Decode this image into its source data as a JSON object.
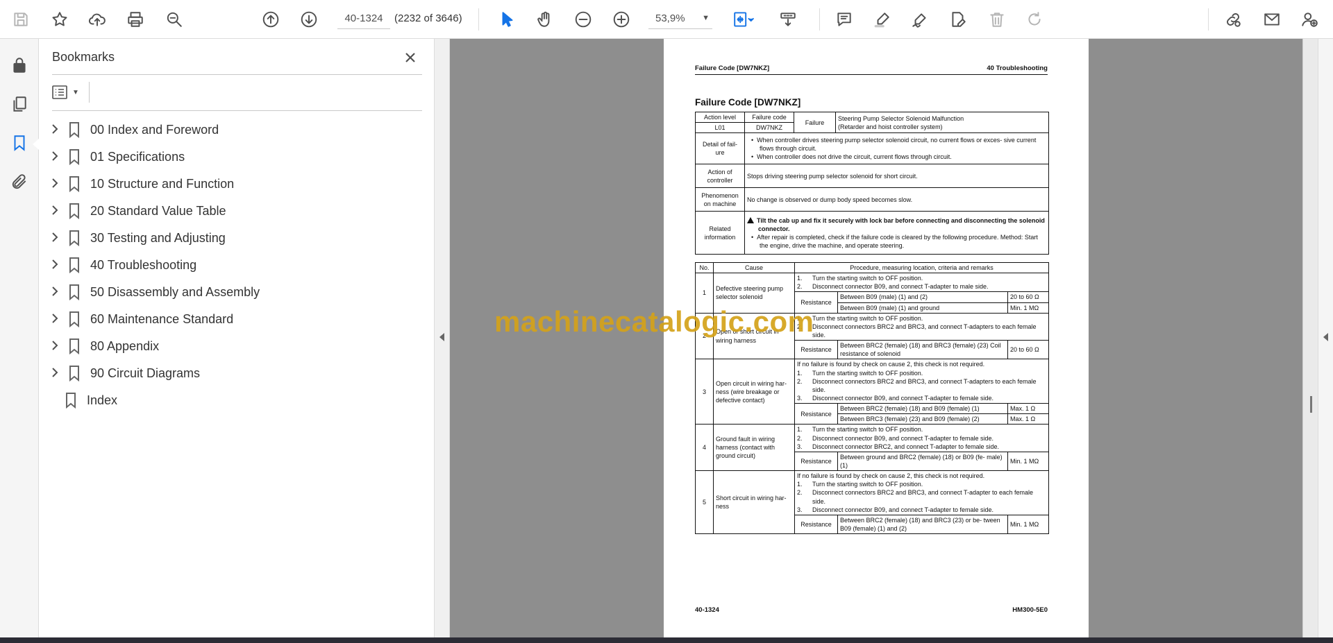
{
  "toolbar": {
    "page_value": "40-1324",
    "page_count": "(2232 of 3646)",
    "zoom": "53,9%"
  },
  "panel": {
    "title": "Bookmarks",
    "bookmarks": [
      {
        "label": "00 Index and Foreword"
      },
      {
        "label": "01 Specifications"
      },
      {
        "label": "10 Structure and Function"
      },
      {
        "label": "20 Standard Value Table"
      },
      {
        "label": "30 Testing and Adjusting"
      },
      {
        "label": "40 Troubleshooting"
      },
      {
        "label": "50 Disassembly and Assembly"
      },
      {
        "label": "60 Maintenance Standard"
      },
      {
        "label": "80 Appendix"
      },
      {
        "label": "90 Circuit Diagrams"
      },
      {
        "label": "Index"
      }
    ]
  },
  "document": {
    "header_left": "Failure Code [DW7NKZ]",
    "header_right": "40 Troubleshooting",
    "title": "Failure Code [DW7NKZ]",
    "info": {
      "action_level_h": "Action level",
      "failure_code_h": "Failure code",
      "failure_h": "Failure",
      "action_level": "L01",
      "failure_code": "DW7NKZ",
      "failure_1": "Steering Pump Selector Solenoid Malfunction",
      "failure_2": "(Retarder and hoist controller system)",
      "detail_h": "Detail of fail- ure",
      "detail_1": "When controller drives steering pump selector solenoid circuit, no current flows or exces- sive current flows through circuit.",
      "detail_2": "When controller does not drive the circuit, current flows through circuit.",
      "action_h": "Action of controller",
      "action": "Stops driving steering pump selector solenoid for short circuit.",
      "phenom_h": "Phenomenon on machine",
      "phenom": "No change is observed or dump body speed becomes slow.",
      "related_h": "Related information",
      "related_warn": "Tilt the cab up and fix it securely with lock bar before connecting and disconnecting the solenoid connector.",
      "related_1": "After repair is completed, check if the failure code is cleared by the following procedure. Method: Start the engine, drive the machine, and operate steering."
    },
    "causes_header": {
      "no": "No.",
      "cause": "Cause",
      "proc": "Procedure, measuring location, criteria and remarks"
    },
    "resistance": "Resistance",
    "c1": {
      "no": "1",
      "cause": "Defective steering pump selector solenoid",
      "s1": "Turn the starting switch to OFF position.",
      "s2": "Disconnect connector B09, and connect T-adapter to male side.",
      "r1": "Between B09 (male) (1) and (2)",
      "v1": "20 to 60 Ω",
      "r2": "Between B09 (male) (1) and ground",
      "v2": "Min. 1 MΩ"
    },
    "c2": {
      "no": "2",
      "cause": "Open or short circuit in wiring harness",
      "s1": "Turn the starting switch to OFF position.",
      "s2": "Disconnect connectors BRC2 and BRC3, and connect T-adapters to each female side.",
      "r1": "Between BRC2 (female) (18) and BRC3 (female) (23) Coil resistance of solenoid",
      "v1": "20 to 60 Ω"
    },
    "c3": {
      "no": "3",
      "cause": "Open circuit in wiring har- ness (wire breakage or defective contact)",
      "note": "If no failure is found by check on cause 2, this check is not required.",
      "s1": "Turn the starting switch to OFF position.",
      "s2": "Disconnect connectors BRC2 and BRC3, and connect T-adapters to each female side.",
      "s3": "Disconnect connector B09, and connect T-adapter to female side.",
      "r1": "Between BRC2 (female) (18) and B09 (female) (1)",
      "v1": "Max. 1 Ω",
      "r2": "Between BRC3 (female) (23) and B09 (female) (2)",
      "v2": "Max. 1 Ω"
    },
    "c4": {
      "no": "4",
      "cause": "Ground fault in wiring harness (contact with ground circuit)",
      "s1": "Turn the starting switch to OFF position.",
      "s2": "Disconnect connector B09, and connect T-adapter to female side.",
      "s3": "Disconnect connector BRC2, and connect T-adapter to female side.",
      "r1": "Between ground and BRC2 (female) (18) or B09 (fe- male) (1)",
      "v1": "Min. 1 MΩ"
    },
    "c5": {
      "no": "5",
      "cause": "Short circuit in wiring har- ness",
      "note": "If no failure is found by check on cause 2, this check is not required.",
      "s1": "Turn the starting switch to OFF position.",
      "s2": "Disconnect connectors BRC2 and BRC3, and connect T-adapter to each female side.",
      "s3": "Disconnect connector B09, and connect T-adapter to female side.",
      "r1": "Between BRC2 (female) (18) and BRC3 (23) or be- tween B09 (female) (1) and (2)",
      "v1": "Min. 1 MΩ"
    },
    "footer_left": "40-1324",
    "footer_right": "HM300-5E0"
  },
  "watermark": "machinecatalogic.com"
}
